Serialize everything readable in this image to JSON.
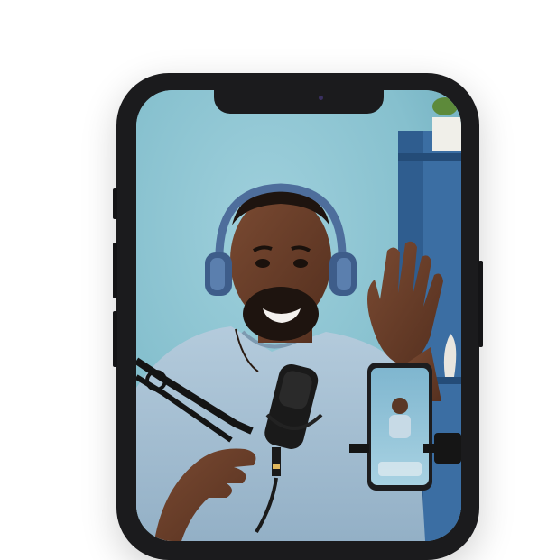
{
  "scene": {
    "subject": "podcast-host",
    "icons": [
      "headphones-icon",
      "microphone-icon",
      "smartphone-icon",
      "camera-icon"
    ],
    "colors": {
      "wall": "#8cc4d1",
      "shelf": "#2f5d8f",
      "skin": "#6b3f2a",
      "shirt": "#a9c3d6",
      "headphones": "#4e6e9c",
      "phone_frame": "#1b1b1d"
    }
  }
}
